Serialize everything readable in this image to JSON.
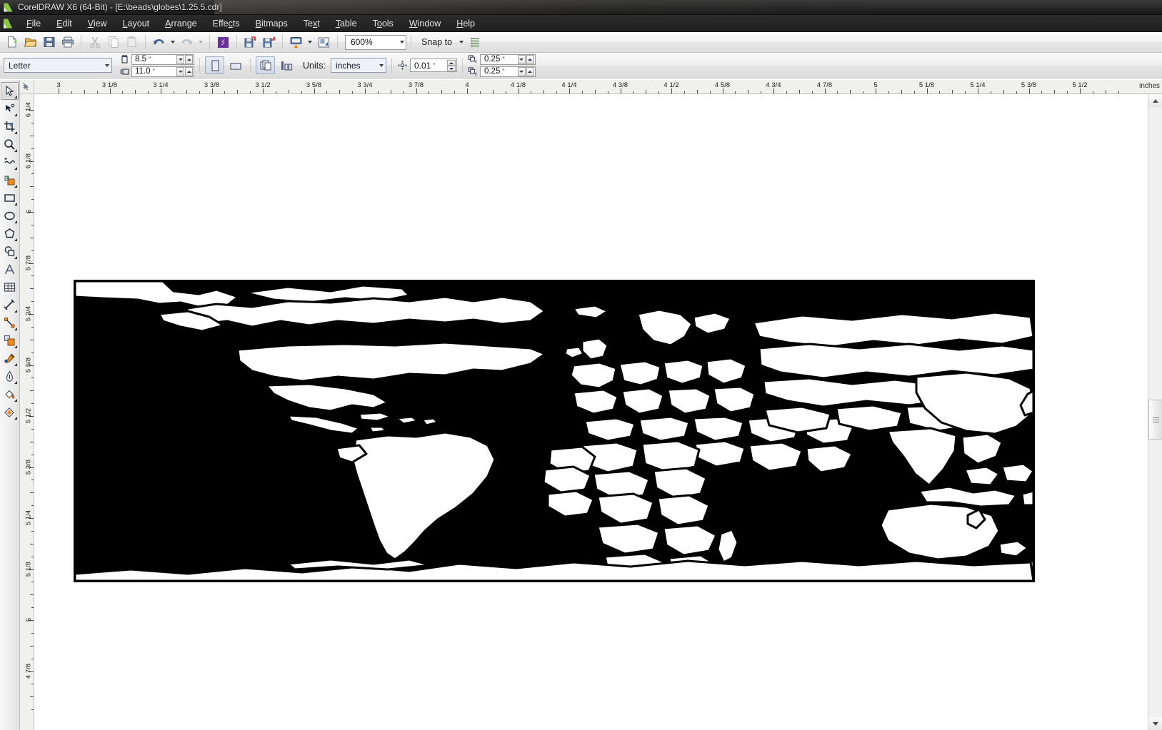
{
  "window": {
    "title": "CorelDRAW X6 (64-Bit) - [E:\\beads\\globes\\1.25.5.cdr]",
    "app_icon": "coreldraw-logo-icon"
  },
  "menubar": {
    "items": [
      {
        "label": "File",
        "mnemonic": "F"
      },
      {
        "label": "Edit",
        "mnemonic": "E"
      },
      {
        "label": "View",
        "mnemonic": "V"
      },
      {
        "label": "Layout",
        "mnemonic": "L"
      },
      {
        "label": "Arrange",
        "mnemonic": "A"
      },
      {
        "label": "Effects",
        "mnemonic": "c"
      },
      {
        "label": "Bitmaps",
        "mnemonic": "B"
      },
      {
        "label": "Text",
        "mnemonic": "x"
      },
      {
        "label": "Table",
        "mnemonic": "T"
      },
      {
        "label": "Tools",
        "mnemonic": "o"
      },
      {
        "label": "Window",
        "mnemonic": "W"
      },
      {
        "label": "Help",
        "mnemonic": "H"
      }
    ]
  },
  "toolbar": {
    "buttons": [
      {
        "name": "new-document-button",
        "icon": "new-page-icon"
      },
      {
        "name": "open-document-button",
        "icon": "open-folder-icon"
      },
      {
        "name": "save-document-button",
        "icon": "floppy-disk-icon"
      },
      {
        "name": "print-button",
        "icon": "printer-icon"
      },
      {
        "name": "cut-button",
        "icon": "scissors-icon"
      },
      {
        "name": "copy-button",
        "icon": "copy-icon"
      },
      {
        "name": "paste-button",
        "icon": "paste-icon"
      },
      {
        "name": "undo-button",
        "icon": "undo-arrow-icon"
      },
      {
        "name": "redo-button",
        "icon": "redo-arrow-icon"
      },
      {
        "name": "search-content-button",
        "icon": "corel-connect-icon"
      },
      {
        "name": "import-button",
        "icon": "import-icon"
      },
      {
        "name": "export-button",
        "icon": "export-icon"
      },
      {
        "name": "publish-pdf-button",
        "icon": "pdf-publish-icon"
      },
      {
        "name": "application-launcher-button",
        "icon": "app-launcher-icon"
      }
    ],
    "zoom_level": "600%",
    "snap_to_label": "Snap to",
    "options_icon": "options-list-icon"
  },
  "propertybar": {
    "paper_type": "Letter",
    "page_width": "8.5",
    "page_height": "11.0",
    "unit_mark": "\"",
    "orientation": {
      "portrait_name": "portrait-button",
      "landscape_name": "landscape-button",
      "portrait_active": true
    },
    "page_scope": {
      "all_pages_name": "all-pages-button",
      "current_page_name": "current-page-button",
      "all_pages_active": true
    },
    "units_label": "Units:",
    "units_value": "inches",
    "nudge_value": "0.01",
    "duplicate_x": "0.25",
    "duplicate_y": "0.25"
  },
  "toolbox": {
    "tools": [
      {
        "name": "pick-tool",
        "icon": "arrow-cursor-icon",
        "selected": true,
        "flyout": true
      },
      {
        "name": "shape-tool",
        "icon": "shape-node-icon",
        "selected": false,
        "flyout": true
      },
      {
        "name": "crop-tool",
        "icon": "crop-icon",
        "selected": false,
        "flyout": true
      },
      {
        "name": "zoom-tool",
        "icon": "magnifier-icon",
        "selected": false,
        "flyout": true
      },
      {
        "name": "freehand-tool",
        "icon": "freehand-curve-icon",
        "selected": false,
        "flyout": true
      },
      {
        "name": "smart-fill-tool",
        "icon": "smart-fill-icon",
        "selected": false,
        "flyout": true
      },
      {
        "name": "rectangle-tool",
        "icon": "rectangle-icon",
        "selected": false,
        "flyout": true
      },
      {
        "name": "ellipse-tool",
        "icon": "ellipse-icon",
        "selected": false,
        "flyout": true
      },
      {
        "name": "polygon-tool",
        "icon": "polygon-icon",
        "selected": false,
        "flyout": true
      },
      {
        "name": "basic-shapes-tool",
        "icon": "basic-shapes-icon",
        "selected": false,
        "flyout": true
      },
      {
        "name": "text-tool",
        "icon": "text-a-icon",
        "selected": false,
        "flyout": false
      },
      {
        "name": "table-tool",
        "icon": "table-grid-icon",
        "selected": false,
        "flyout": false
      },
      {
        "name": "dimension-tool",
        "icon": "dimension-line-icon",
        "selected": false,
        "flyout": true
      },
      {
        "name": "connector-tool",
        "icon": "connector-line-icon",
        "selected": false,
        "flyout": true
      },
      {
        "name": "blend-tool",
        "icon": "blend-shapes-icon",
        "selected": false,
        "flyout": true
      },
      {
        "name": "color-eyedropper-tool",
        "icon": "eyedropper-icon",
        "selected": false,
        "flyout": true
      },
      {
        "name": "outline-pen-tool",
        "icon": "outline-pen-nib-icon",
        "selected": false,
        "flyout": true
      },
      {
        "name": "fill-tool",
        "icon": "paint-bucket-icon",
        "selected": false,
        "flyout": true
      },
      {
        "name": "interactive-fill-tool",
        "icon": "interactive-fill-icon",
        "selected": false,
        "flyout": true
      }
    ]
  },
  "rulers": {
    "unit_label": "inches",
    "horizontal_labels": [
      "3",
      "3 1/8",
      "3 1/4",
      "3 3/8",
      "3 1/2",
      "3 5/8",
      "3 3/4",
      "3 7/8",
      "4",
      "4 1/8",
      "4 1/4",
      "4 3/8",
      "4 1/2",
      "4 5/8",
      "4 3/4",
      "4 7/8",
      "5",
      "5 1/8",
      "5 1/4",
      "5 3/8",
      "5 1/2"
    ],
    "vertical_labels": [
      "6 1/4",
      "6 1/8",
      "6",
      "5 7/8",
      "5 3/4",
      "5 5/8",
      "5 1/2",
      "5 3/8",
      "5 1/4",
      "5 1/8",
      "5",
      "4 7/8"
    ]
  },
  "artwork": {
    "name": "world-map-vector",
    "description": "Black rectangle background with white landmass country shapes",
    "background_color": "#000000",
    "land_color": "#ffffff",
    "outline_color": "#000000"
  },
  "scrollbar": {
    "up_arrow": "scroll-up-arrow-icon",
    "down_arrow": "scroll-down-arrow-icon",
    "thumb": "vertical-scroll-thumb"
  }
}
